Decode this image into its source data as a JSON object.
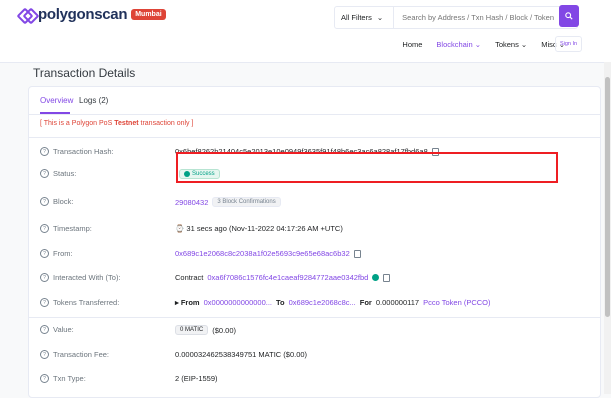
{
  "header": {
    "logo_text": "polygonscan",
    "network_badge": "Mumbai",
    "filter_label": "All Filters",
    "filter_chevron": "⌄",
    "search_placeholder": "Search by Address / Txn Hash / Block / Token",
    "nav": [
      {
        "label": "Home"
      },
      {
        "label": "Blockchain ⌄"
      },
      {
        "label": "Tokens ⌄"
      },
      {
        "label": "Misc ⌄"
      }
    ],
    "sign_in": "Sign In"
  },
  "page": {
    "title": "Transaction Details"
  },
  "tabs": [
    {
      "label": "Overview"
    },
    {
      "label": "Logs (2)"
    }
  ],
  "notice": {
    "prefix": "[ This is a Polygon PoS ",
    "bold": "Testnet",
    "suffix": " transaction only ]"
  },
  "rows": {
    "hash": {
      "label": "Transaction Hash:",
      "value": "0x6bef8262b21404c5e2013e10e0949f3635f91f48b6ec3ac6a828af17fbd6a8"
    },
    "status": {
      "label": "Status:",
      "value": "Success"
    },
    "block": {
      "label": "Block:",
      "value": "29080432",
      "confirmations": "3 Block Confirmations"
    },
    "timestamp": {
      "label": "Timestamp:",
      "value": "⌚ 31 secs ago (Nov-11-2022 04:17:26 AM +UTC)"
    },
    "from": {
      "label": "From:",
      "value": "0x689c1e2068c8c2038a1f02e5693c9e65e68ac6b32"
    },
    "interacted": {
      "label": "Interacted With (To):",
      "prefix": "Contract",
      "value": "0xa6f7086c1576fc4e1caeaf9284772aae0342fbd"
    },
    "tokens": {
      "label": "Tokens Transferred:",
      "from_label": "▸ From",
      "from_value": "0x0000000000000...",
      "to_label": "To",
      "to_value": "0x689c1e2068c8c...",
      "for_label": "For",
      "amount": "0.000000117",
      "token": "Pcco Token (PCCO)"
    },
    "value": {
      "label": "Value:",
      "amount": "0 MATIC",
      "usd": "($0.00)"
    },
    "fee": {
      "label": "Transaction Fee:",
      "value": "0.000032462538349751 MATIC ($0.00)"
    },
    "txn_type": {
      "label": "Txn Type:",
      "value": "2 (EIP-1559)"
    }
  },
  "colors": {
    "accent": "#8247e5",
    "success": "#00a186",
    "highlight": "#ee1e23",
    "warning": "#de4437"
  }
}
